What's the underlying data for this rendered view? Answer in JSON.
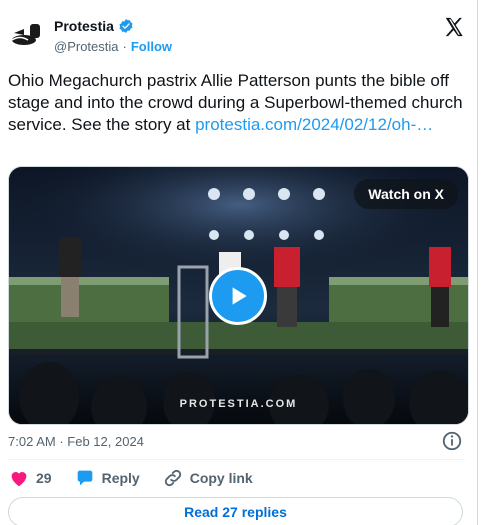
{
  "header": {
    "name": "Protestia",
    "handle": "@Protestia",
    "separator": "·",
    "follow_label": "Follow"
  },
  "tweet": {
    "text": "Ohio Megachurch pastrix Allie Patterson punts the bible off stage and into the crowd during a  Superbowl-themed church service. See the story at ",
    "link_text": "protestia.com/2024/02/12/oh-…"
  },
  "media": {
    "watch_label": "Watch on X",
    "watermark": "PROTESTIA.COM"
  },
  "meta": {
    "time": "7:02 AM",
    "separator": "·",
    "date": "Feb 12, 2024"
  },
  "actions": {
    "like_count": "29",
    "reply_label": "Reply",
    "copy_label": "Copy link"
  },
  "replies_button": "Read 27 replies",
  "colors": {
    "accent": "#1d9bf0",
    "like": "#f91880",
    "text": "#0f1419",
    "muted": "#536471"
  },
  "icons": [
    "protestia-logo-icon",
    "verified-badge-icon",
    "x-logo-icon",
    "play-icon",
    "info-icon",
    "heart-icon",
    "reply-icon",
    "link-icon"
  ]
}
